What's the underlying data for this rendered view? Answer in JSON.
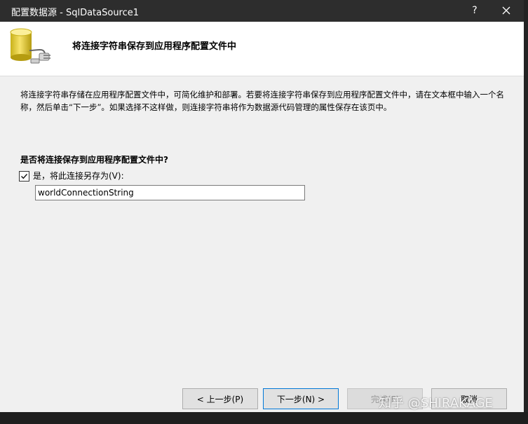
{
  "window": {
    "title": "配置数据源 - SqlDataSource1",
    "help_label": "?",
    "close_label": "✕"
  },
  "header": {
    "heading": "将连接字符串保存到应用程序配置文件中"
  },
  "description": "将连接字符串存储在应用程序配置文件中，可简化维护和部署。若要将连接字符串保存到应用程序配置文件中，请在文本框中输入一个名称，然后单击“下一步”。如果选择不这样做，则连接字符串将作为数据源代码管理的属性保存在该页中。",
  "save_section": {
    "question": "是否将连接保存到应用程序配置文件中?",
    "checkbox_label": "是，将此连接另存为(V):",
    "checkbox_checked": true,
    "connection_name": "worldConnectionString"
  },
  "buttons": {
    "prev": "< 上一步(P)",
    "next": "下一步(N) >",
    "finish": "完成(F)",
    "cancel": "取消"
  },
  "watermark": "知乎 @SHIRAKAGE",
  "colors": {
    "titlebar": "#2d2d2d",
    "accent": "#0078d7",
    "dialog_bg": "#f0f0f0"
  }
}
